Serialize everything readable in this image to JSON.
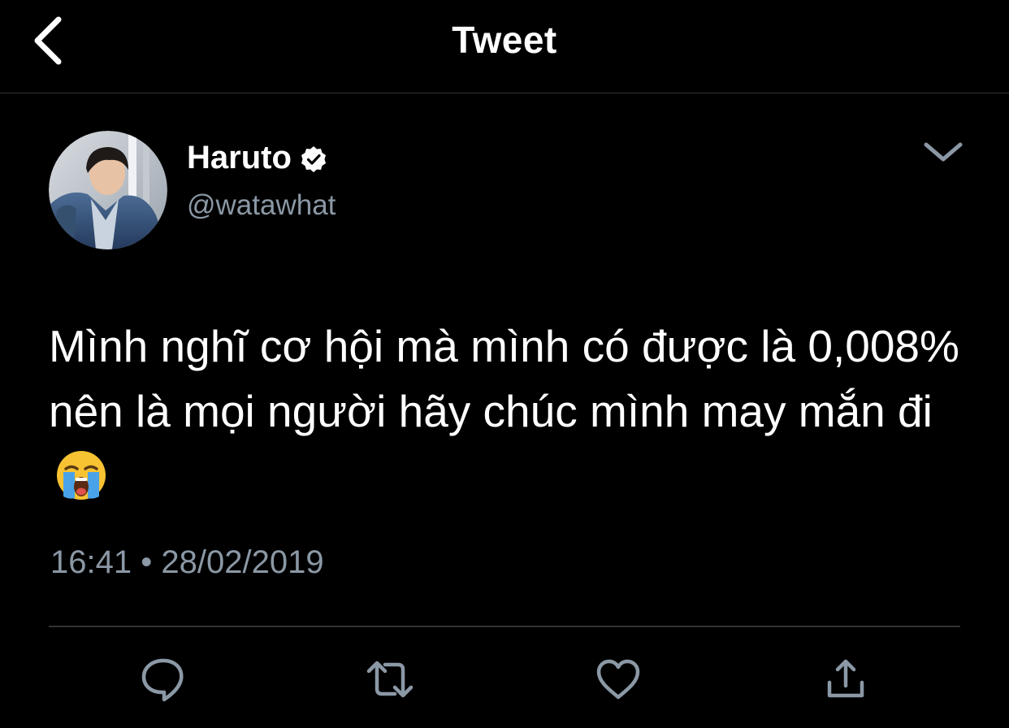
{
  "header": {
    "title": "Tweet",
    "back_icon": "chevron-left-icon"
  },
  "tweet": {
    "author": {
      "display_name": "Haruto",
      "handle": "@watawhat",
      "verified": true
    },
    "text": "Mình nghĩ cơ hội mà mình có được là 0,008% nên là mọi người hãy chúc mình may mắn đi",
    "emoji": "loudly-crying-face",
    "time": "16:41",
    "separator": "•",
    "date": "28/02/2019"
  },
  "actions": [
    {
      "name": "reply",
      "icon": "reply-icon"
    },
    {
      "name": "retweet",
      "icon": "retweet-icon"
    },
    {
      "name": "like",
      "icon": "heart-icon"
    },
    {
      "name": "share",
      "icon": "share-icon"
    }
  ],
  "colors": {
    "background": "#000000",
    "text": "#ffffff",
    "secondary_text": "#8b98a5",
    "divider": "#2f3336"
  }
}
